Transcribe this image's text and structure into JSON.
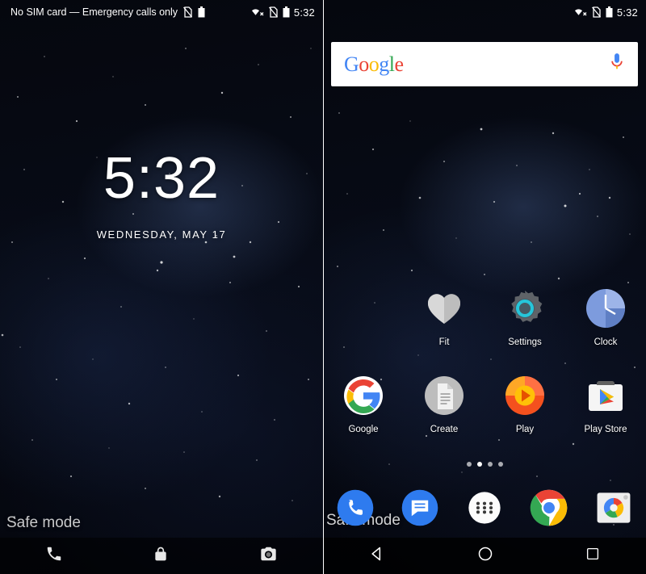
{
  "lock_screen": {
    "status_bar": {
      "carrier_text": "No SIM card — Emergency calls only",
      "icons": [
        "no-sim-icon",
        "battery-icon"
      ],
      "right_icons": [
        "wifi-off-icon",
        "no-sim-icon",
        "battery-icon"
      ],
      "clock": "5:32"
    },
    "clock": "5:32",
    "date": "WEDNESDAY, MAY 17",
    "safe_mode_label": "Safe mode",
    "shortcuts": [
      {
        "name": "phone-shortcut",
        "icon": "phone-icon"
      },
      {
        "name": "lock-indicator",
        "icon": "lock-icon"
      },
      {
        "name": "camera-shortcut",
        "icon": "camera-icon"
      }
    ]
  },
  "home_screen": {
    "status_bar": {
      "clock": "5:32",
      "right_icons": [
        "wifi-off-icon",
        "no-sim-icon",
        "battery-icon"
      ]
    },
    "search": {
      "logo_letters": [
        "G",
        "o",
        "o",
        "g",
        "l",
        "e"
      ],
      "mic_icon": "microphone-icon"
    },
    "apps": [
      [
        {
          "label": "",
          "icon": "empty",
          "visible": false
        },
        {
          "label": "Fit",
          "icon": "fit-icon",
          "visible": true
        },
        {
          "label": "Settings",
          "icon": "settings-icon",
          "visible": true
        },
        {
          "label": "Clock",
          "icon": "clock-icon",
          "visible": true
        }
      ],
      [
        {
          "label": "Google",
          "icon": "google-icon",
          "visible": true
        },
        {
          "label": "Create",
          "icon": "docs-icon",
          "visible": true
        },
        {
          "label": "Play",
          "icon": "play-music-icon",
          "visible": true
        },
        {
          "label": "Play Store",
          "icon": "play-store-icon",
          "visible": true
        }
      ]
    ],
    "page_dots": {
      "count": 4,
      "active_index": 1
    },
    "safe_mode_label": "Safe mode",
    "dock": [
      {
        "name": "phone-app",
        "icon": "phone-icon"
      },
      {
        "name": "messages-app",
        "icon": "messages-icon"
      },
      {
        "name": "all-apps-button",
        "icon": "apps-grid-icon"
      },
      {
        "name": "chrome-app",
        "icon": "chrome-icon"
      },
      {
        "name": "camera-app",
        "icon": "camera-icon"
      }
    ],
    "nav_bar": [
      {
        "name": "back-button",
        "icon": "back-triangle-icon"
      },
      {
        "name": "home-button",
        "icon": "home-circle-icon"
      },
      {
        "name": "recents-button",
        "icon": "recents-square-icon"
      }
    ]
  },
  "colors": {
    "google_blue": "#4285F4",
    "google_red": "#EA4335",
    "google_yellow": "#FBBC05",
    "google_green": "#34A853",
    "settings_teal": "#26C6DA",
    "clock_blue": "#5B7FD4"
  }
}
